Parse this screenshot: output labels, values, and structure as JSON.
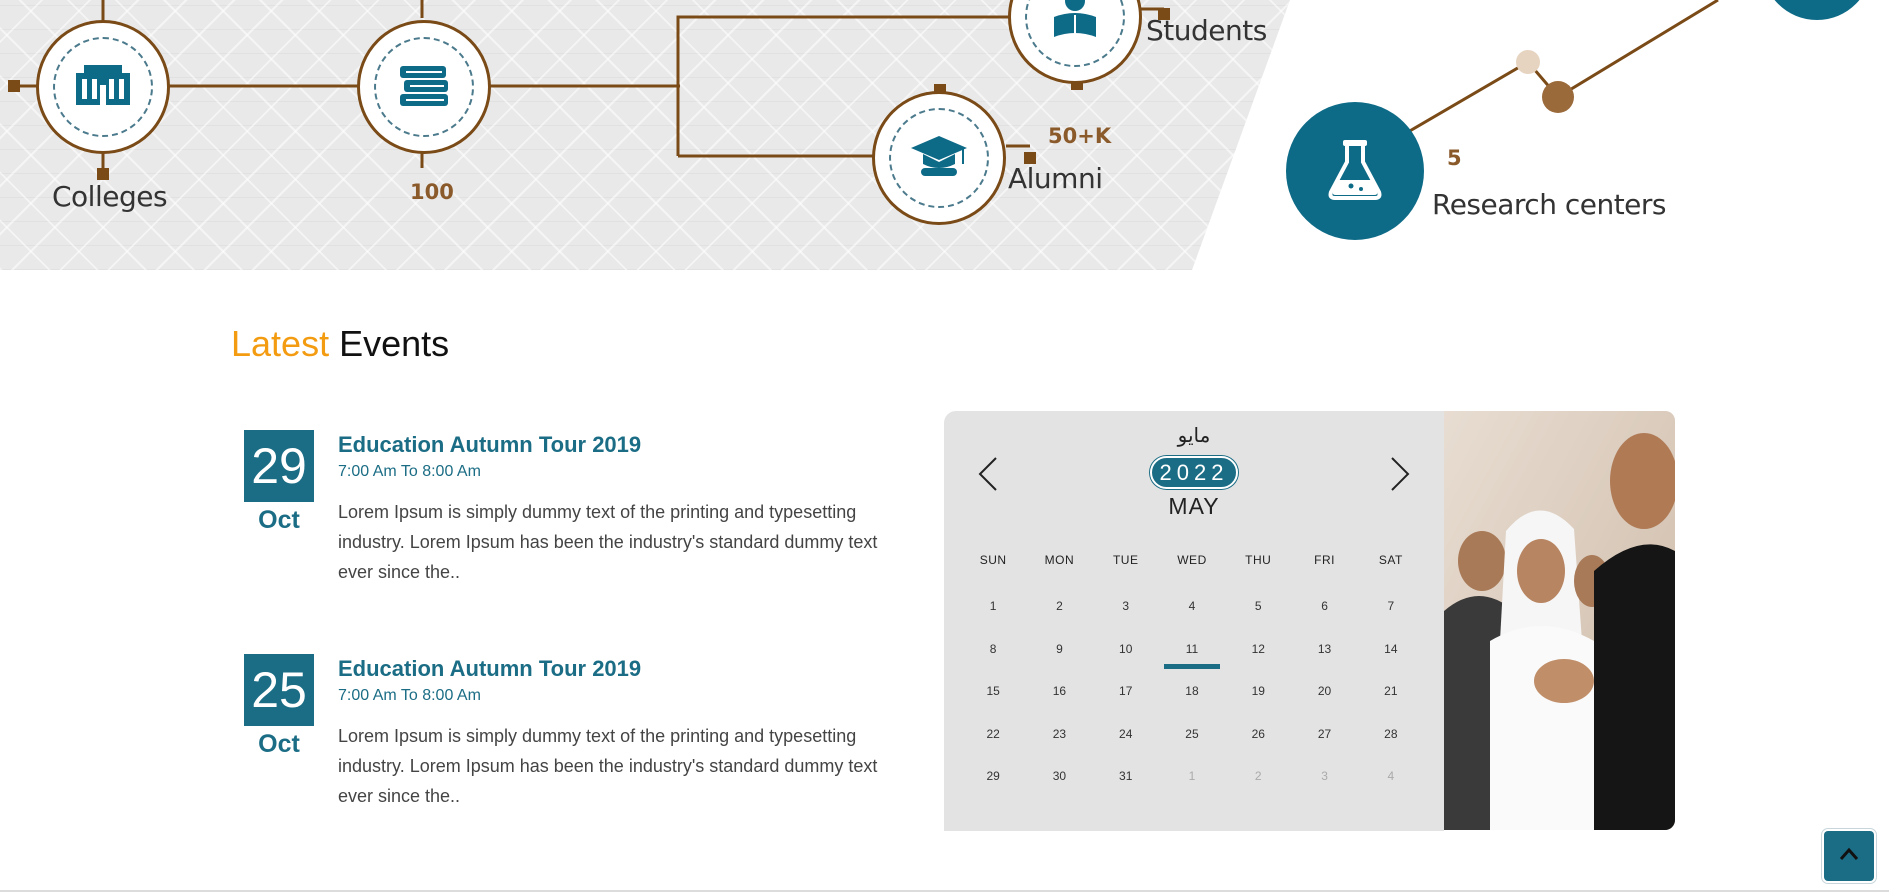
{
  "stats": {
    "colleges": {
      "label": "Colleges"
    },
    "books": {
      "number": "100"
    },
    "students": {
      "label": "Students"
    },
    "alumni": {
      "number": "50+K",
      "label": "Alumni"
    },
    "research": {
      "number": "5",
      "label": "Research centers"
    }
  },
  "events_section": {
    "title_accent": "Latest",
    "title_rest": "Events",
    "events": [
      {
        "day": "29",
        "month": "Oct",
        "title": "Education Autumn Tour 2019",
        "time": "7:00 Am To 8:00 Am",
        "description": "Lorem Ipsum is simply dummy text of the printing and typesetting industry. Lorem Ipsum has been the industry's standard dummy text ever since the.."
      },
      {
        "day": "25",
        "month": "Oct",
        "title": "Education Autumn Tour 2019",
        "time": "7:00 Am To 8:00 Am",
        "description": "Lorem Ipsum is simply dummy text of the printing and typesetting industry. Lorem Ipsum has been the industry's standard dummy text ever since the.."
      }
    ]
  },
  "calendar": {
    "month_ar": "مايو",
    "year": "2022",
    "month_en": "MAY",
    "weekdays": [
      "SUN",
      "MON",
      "TUE",
      "WED",
      "THU",
      "FRI",
      "SAT"
    ],
    "weeks": [
      [
        "1",
        "2",
        "3",
        "4",
        "5",
        "6",
        "7"
      ],
      [
        "8",
        "9",
        "10",
        "11",
        "12",
        "13",
        "14"
      ],
      [
        "15",
        "16",
        "17",
        "18",
        "19",
        "20",
        "21"
      ],
      [
        "22",
        "23",
        "24",
        "25",
        "26",
        "27",
        "28"
      ],
      [
        "29",
        "30",
        "31",
        "1",
        "2",
        "3",
        "4"
      ]
    ],
    "today": "11"
  },
  "colors": {
    "primary": "#1b6d85",
    "accent": "#f39c12",
    "brown": "#7a4a17"
  },
  "icons": {
    "colleges": "building-icon",
    "books": "books-icon",
    "students": "student-reading-icon",
    "alumni": "graduation-cap-icon",
    "research": "flask-icon",
    "prev": "chevron-left-icon",
    "next": "chevron-right-icon",
    "back_top": "chevron-up-icon"
  }
}
